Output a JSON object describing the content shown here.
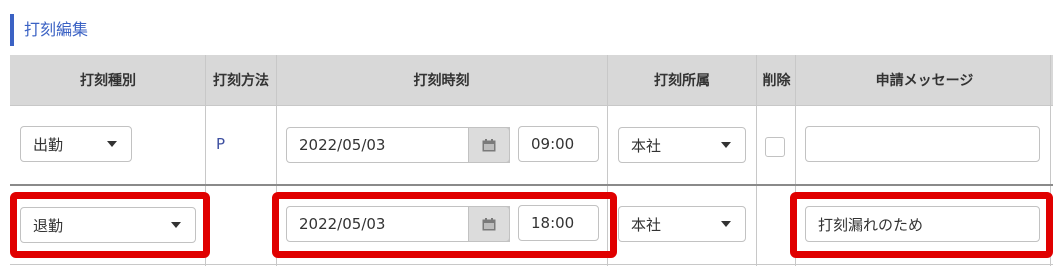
{
  "section": {
    "title": "打刻編集"
  },
  "headers": {
    "type": "打刻種別",
    "method": "打刻方法",
    "time": "打刻時刻",
    "location": "打刻所属",
    "delete": "削除",
    "message": "申請メッセージ"
  },
  "rows": [
    {
      "type": "出勤",
      "method": "P",
      "date": "2022/05/03",
      "time": "09:00",
      "location": "本社",
      "message": ""
    },
    {
      "type": "退勤",
      "method": "",
      "date": "2022/05/03",
      "time": "18:00",
      "location": "本社",
      "message": "打刻漏れのため"
    }
  ],
  "colors": {
    "accent": "#3b62c4",
    "highlight": "#e00000",
    "header_bg": "#d8d8d8"
  },
  "icons": {
    "calendar": "calendar-icon",
    "dropdown": "chevron-down-icon"
  }
}
